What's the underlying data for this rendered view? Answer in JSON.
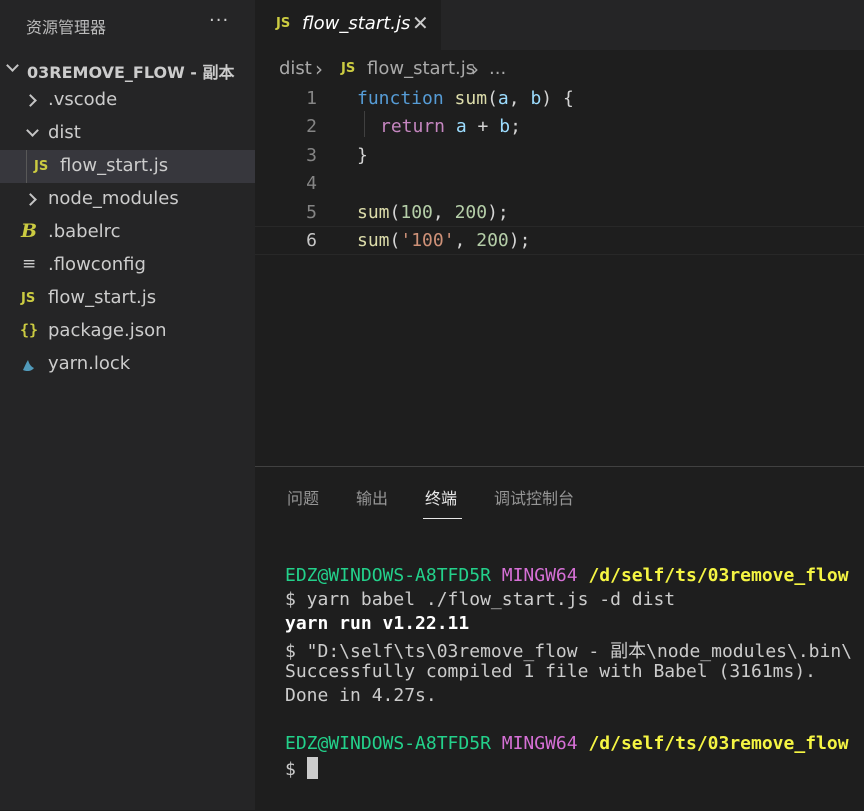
{
  "sidebar": {
    "title": "资源管理器",
    "more_icon": "ellipsis-icon",
    "root_folder": "03REMOVE_FLOW - 副本",
    "items": [
      {
        "label": ".vscode",
        "icon": "chevron-right-icon"
      },
      {
        "label": "dist",
        "icon": "chevron-down-icon"
      },
      {
        "label": "flow_start.js",
        "icon": "js-file-icon",
        "icon_text": "JS"
      },
      {
        "label": "node_modules",
        "icon": "chevron-right-icon"
      },
      {
        "label": ".babelrc",
        "icon": "babel-icon",
        "icon_text": "B"
      },
      {
        "label": ".flowconfig",
        "icon": "config-lines-icon",
        "icon_text": "≡"
      },
      {
        "label": "flow_start.js",
        "icon": "js-file-icon",
        "icon_text": "JS"
      },
      {
        "label": "package.json",
        "icon": "json-braces-icon",
        "icon_text": "{}"
      },
      {
        "label": "yarn.lock",
        "icon": "yarn-icon"
      }
    ]
  },
  "tab": {
    "icon_text": "JS",
    "title": "flow_start.js",
    "close": "✕"
  },
  "breadcrumb": {
    "folder": "dist",
    "sep": "›",
    "icon_text": "JS",
    "file": "flow_start.js",
    "tail": "..."
  },
  "editor": {
    "line_numbers": [
      "1",
      "2",
      "3",
      "4",
      "5",
      "6"
    ],
    "lines": [
      [
        "function",
        " ",
        "sum",
        "(",
        "a",
        ", ",
        "b",
        ") {"
      ],
      [
        "return",
        " ",
        "a",
        " + ",
        "b",
        ";"
      ],
      [
        "}"
      ],
      [
        ""
      ],
      [
        "sum",
        "(",
        "100",
        ", ",
        "200",
        ");"
      ],
      [
        "sum",
        "(",
        "'100'",
        ", ",
        "200",
        ");"
      ]
    ]
  },
  "panel": {
    "tabs": [
      "问题",
      "输出",
      "终端",
      "调试控制台"
    ],
    "active_tab": "终端"
  },
  "terminal": {
    "user_host": "EDZ@WINDOWS-A8TFD5R",
    "env": "MINGW64",
    "path": "/d/self/ts/03remove_flow",
    "cmd": "$ yarn babel ./flow_start.js -d dist",
    "yarn_version": "yarn run v1.22.11",
    "exec": "$ \"D:\\self\\ts\\03remove_flow - 副本\\node_modules\\.bin\\",
    "success": "Successfully compiled 1 file with Babel (3161ms).",
    "done": "Done in 4.27s.",
    "prompt": "$"
  }
}
